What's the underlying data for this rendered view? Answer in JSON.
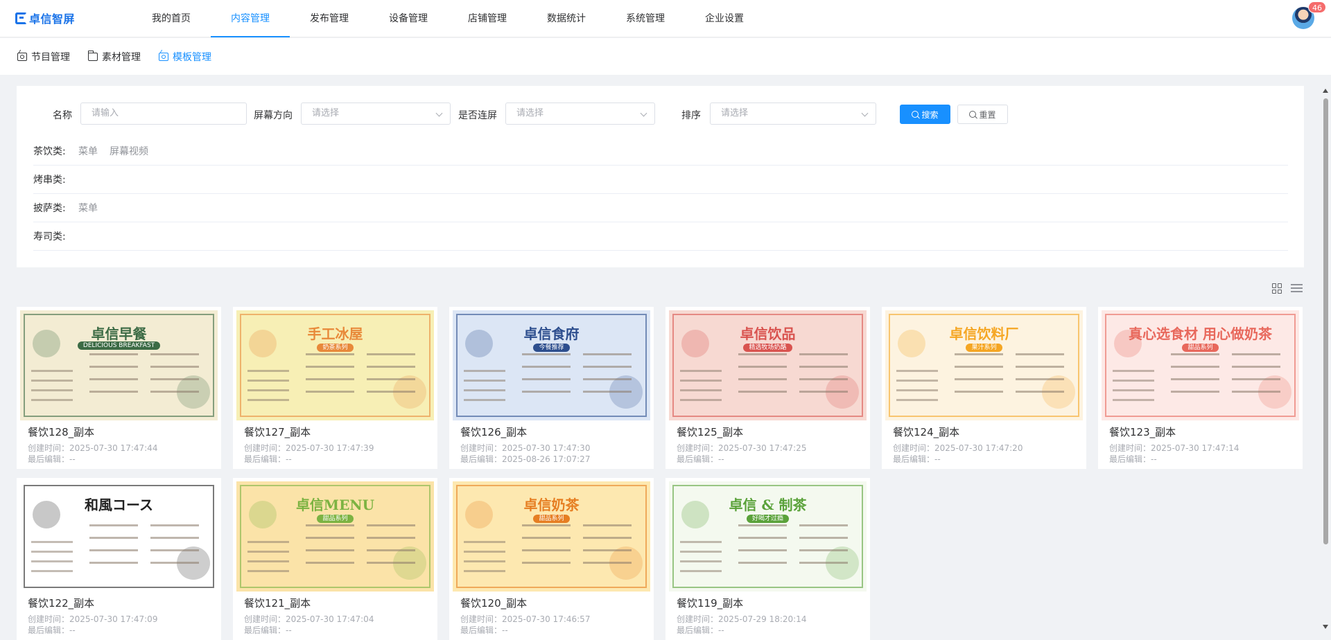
{
  "app": {
    "logo_text": "卓信智屏",
    "notification_count": "46"
  },
  "nav": {
    "items": [
      "我的首页",
      "内容管理",
      "发布管理",
      "设备管理",
      "店铺管理",
      "数据统计",
      "系统管理",
      "企业设置"
    ],
    "active": "内容管理"
  },
  "subnav": {
    "items": [
      {
        "label": "节目管理",
        "icon": "tv-icon"
      },
      {
        "label": "素材管理",
        "icon": "folder-icon"
      },
      {
        "label": "模板管理",
        "icon": "tv-icon"
      }
    ],
    "active": "模板管理"
  },
  "filters": {
    "name": {
      "label": "名称",
      "placeholder": "请输入",
      "value": ""
    },
    "orientation": {
      "label": "屏幕方向",
      "placeholder": "请选择",
      "value": ""
    },
    "linked": {
      "label": "是否连屏",
      "placeholder": "请选择",
      "value": ""
    },
    "sort": {
      "label": "排序",
      "placeholder": "请选择",
      "value": ""
    },
    "search_label": "搜索",
    "reset_label": "重置"
  },
  "categories": [
    {
      "name": "茶饮类:",
      "tags": [
        "菜单",
        "屏幕视频"
      ]
    },
    {
      "name": "烤串类:",
      "tags": []
    },
    {
      "name": "披萨类:",
      "tags": [
        "菜单"
      ]
    },
    {
      "name": "寿司类:",
      "tags": []
    }
  ],
  "cards": [
    {
      "title": "餐饮128_副本",
      "created": "创建时间：2025-07-30 17:47:44",
      "edited": "最后编辑：--",
      "thumb": {
        "heading": "卓信早餐",
        "sub": "DELICIOUS BREAKFAST",
        "bg": "#f3ecd3",
        "accent": "#3c6b45"
      }
    },
    {
      "title": "餐饮127_副本",
      "created": "创建时间：2025-07-30 17:47:39",
      "edited": "最后编辑：--",
      "thumb": {
        "heading": "手工冰屋",
        "sub": "奶茶系列",
        "bg": "#f7efb5",
        "accent": "#e8893a"
      }
    },
    {
      "title": "餐饮126_副本",
      "created": "创建时间：2025-07-30 17:47:30",
      "edited": "最后编辑：2025-08-26 17:07:27",
      "thumb": {
        "heading": "卓信食府",
        "sub": "今餐推荐",
        "bg": "#dce6f5",
        "accent": "#2d4e8e"
      }
    },
    {
      "title": "餐饮125_副本",
      "created": "创建时间：2025-07-30 17:47:25",
      "edited": "最后编辑：--",
      "thumb": {
        "heading": "卓信饮品",
        "sub": "精选牧场奶酪",
        "bg": "#f7d9d2",
        "accent": "#d9534f"
      }
    },
    {
      "title": "餐饮124_副本",
      "created": "创建时间：2025-07-30 17:47:20",
      "edited": "最后编辑：--",
      "thumb": {
        "heading": "卓信饮料厂",
        "sub": "果汁系列",
        "bg": "#fdf3e0",
        "accent": "#f5a623"
      }
    },
    {
      "title": "餐饮123_副本",
      "created": "创建时间：2025-07-30 17:47:14",
      "edited": "最后编辑：--",
      "thumb": {
        "heading": "真心选食材 用心做奶茶",
        "sub": "甜品系列",
        "bg": "#fde9e6",
        "accent": "#e8685c"
      }
    },
    {
      "title": "餐饮122_副本",
      "created": "创建时间：2025-07-30 17:47:09",
      "edited": "最后编辑：--",
      "thumb": {
        "heading": "和風コース",
        "sub": "",
        "bg": "#ffffff",
        "accent": "#222222"
      }
    },
    {
      "title": "餐饮121_副本",
      "created": "创建时间：2025-07-30 17:47:04",
      "edited": "最后编辑：--",
      "thumb": {
        "heading": "卓信MENU",
        "sub": "甜品系列",
        "bg": "#fbe3a8",
        "accent": "#7cb342"
      }
    },
    {
      "title": "餐饮120_副本",
      "created": "创建时间：2025-07-30 17:46:57",
      "edited": "最后编辑：--",
      "thumb": {
        "heading": "卓信奶茶",
        "sub": "甜品系列",
        "bg": "#fde8b0",
        "accent": "#e67e22"
      }
    },
    {
      "title": "餐饮119_副本",
      "created": "创建时间：2025-07-29 18:20:14",
      "edited": "最后编辑：--",
      "thumb": {
        "heading": "卓信 & 制茶",
        "sub": "好喝才过瘾",
        "bg": "#f4f9ef",
        "accent": "#5aa23a"
      }
    }
  ]
}
